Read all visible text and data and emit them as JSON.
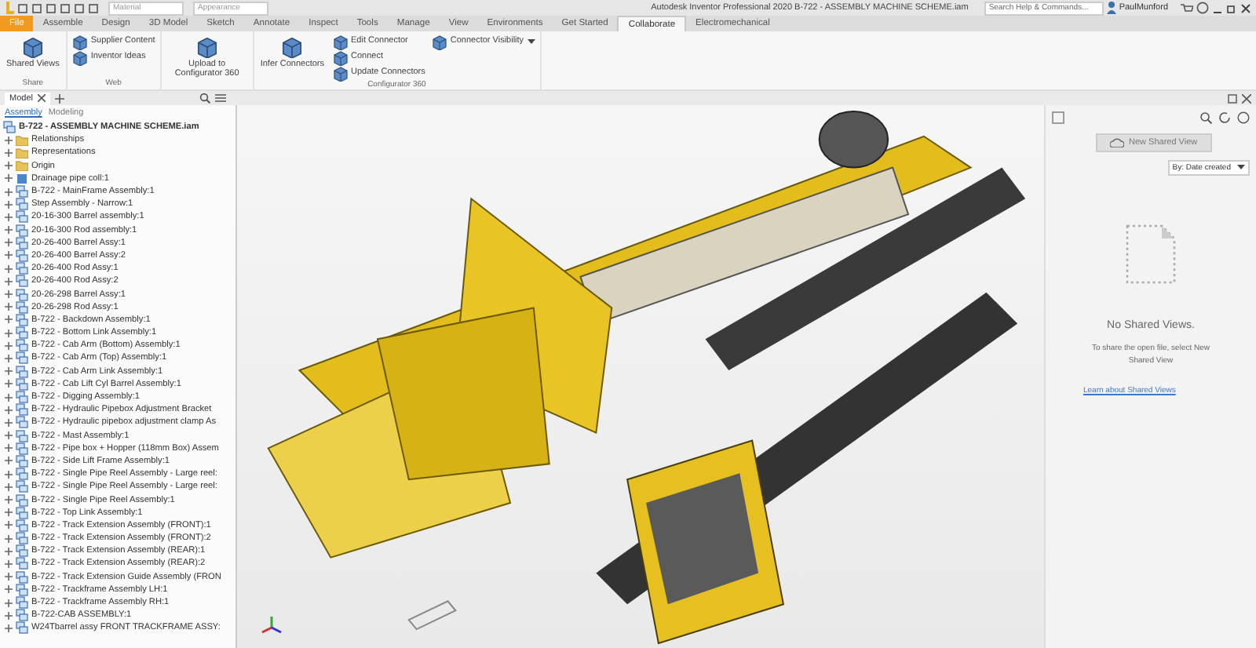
{
  "window": {
    "title": "Autodesk Inventor Professional 2020   B-722 - ASSEMBLY MACHINE SCHEME.iam"
  },
  "quick_access": {
    "material": "Material",
    "appearance": "Appearance"
  },
  "search": {
    "placeholder": "Search Help & Commands..."
  },
  "user": {
    "name": "PaulMunford"
  },
  "ribbon_tabs": [
    {
      "label": "File",
      "selected": false,
      "kind": "file"
    },
    {
      "label": "Assemble",
      "selected": false
    },
    {
      "label": "Design",
      "selected": false
    },
    {
      "label": "3D Model",
      "selected": false
    },
    {
      "label": "Sketch",
      "selected": false
    },
    {
      "label": "Annotate",
      "selected": false
    },
    {
      "label": "Inspect",
      "selected": false
    },
    {
      "label": "Tools",
      "selected": false
    },
    {
      "label": "Manage",
      "selected": false
    },
    {
      "label": "View",
      "selected": false
    },
    {
      "label": "Environments",
      "selected": false
    },
    {
      "label": "Get Started",
      "selected": false
    },
    {
      "label": "Collaborate",
      "selected": true
    },
    {
      "label": "Electromechanical",
      "selected": false
    }
  ],
  "ribbon_groups": [
    {
      "label": "Share",
      "buttons": [
        {
          "label": "Shared Views",
          "kind": "large"
        }
      ]
    },
    {
      "label": "Web",
      "buttons": [
        {
          "label": "Supplier Content",
          "kind": "small"
        },
        {
          "label": "Inventor Ideas",
          "kind": "small"
        }
      ]
    },
    {
      "buttons": [
        {
          "label": "Upload to Configurator 360",
          "kind": "large"
        }
      ]
    },
    {
      "label": "Configurator 360",
      "buttons": [
        {
          "label": "Infer Connectors",
          "kind": "large"
        },
        {
          "label": "Edit Connector",
          "kind": "small"
        },
        {
          "label": "Connect",
          "kind": "small"
        },
        {
          "label": "Update Connectors",
          "kind": "small"
        },
        {
          "label": "Connector Visibility",
          "kind": "menu"
        }
      ]
    }
  ],
  "browser": {
    "tab": "Model",
    "subtabs": [
      {
        "label": "Assembly",
        "selected": true
      },
      {
        "label": "Modeling",
        "selected": false
      }
    ],
    "tree": [
      {
        "label": "B-722 - ASSEMBLY MACHINE SCHEME.iam",
        "kind": "assembly",
        "children": [
          {
            "label": "Relationships",
            "kind": "folder",
            "expanded": false
          },
          {
            "label": "Representations",
            "kind": "folder",
            "expanded": false
          },
          {
            "label": "Origin",
            "kind": "folder",
            "expanded": false
          },
          {
            "label": "Drainage pipe coll:1",
            "kind": "part",
            "expanded": false
          },
          {
            "label": "B-722 - MainFrame Assembly:1",
            "kind": "assembly",
            "expanded": false
          },
          {
            "label": "Step Assembly - Narrow:1",
            "kind": "assembly",
            "expanded": false
          },
          {
            "label": "20-16-300 Barrel assembly:1",
            "kind": "assembly",
            "expanded": false
          },
          {
            "label": "20-16-300 Rod assembly:1",
            "kind": "assembly",
            "expanded": false
          },
          {
            "label": "20-26-400 Barrel Assy:1",
            "kind": "assembly",
            "expanded": false
          },
          {
            "label": "20-26-400 Barrel Assy:2",
            "kind": "assembly",
            "expanded": false
          },
          {
            "label": "20-26-400 Rod Assy:1",
            "kind": "assembly",
            "expanded": false
          },
          {
            "label": "20-26-400 Rod Assy:2",
            "kind": "assembly",
            "expanded": false
          },
          {
            "label": "20-26-298 Barrel Assy:1",
            "kind": "assembly",
            "expanded": false
          },
          {
            "label": "20-26-298 Rod Assy:1",
            "kind": "assembly",
            "expanded": false
          },
          {
            "label": "B-722 - Backdown Assembly:1",
            "kind": "assembly",
            "expanded": false
          },
          {
            "label": "B-722 - Bottom Link Assembly:1",
            "kind": "assembly",
            "expanded": false
          },
          {
            "label": "B-722 - Cab Arm (Bottom) Assembly:1",
            "kind": "assembly",
            "expanded": false
          },
          {
            "label": "B-722 - Cab Arm (Top) Assembly:1",
            "kind": "assembly",
            "expanded": false
          },
          {
            "label": "B-722 - Cab Arm Link Assembly:1",
            "kind": "assembly",
            "expanded": false
          },
          {
            "label": "B-722 - Cab Lift Cyl Barrel Assembly:1",
            "kind": "assembly",
            "expanded": false
          },
          {
            "label": "B-722 - Digging Assembly:1",
            "kind": "assembly",
            "expanded": false
          },
          {
            "label": "B-722 - Hydraulic Pipebox Adjustment Bracket",
            "kind": "assembly",
            "expanded": false
          },
          {
            "label": "B-722 - Hydraulic pipebox adjustment clamp As",
            "kind": "assembly",
            "expanded": false
          },
          {
            "label": "B-722 - Mast Assembly:1",
            "kind": "assembly",
            "expanded": false
          },
          {
            "label": "B-722 - Pipe box + Hopper (118mm Box) Assem",
            "kind": "assembly",
            "expanded": false
          },
          {
            "label": "B-722 - Side Lift Frame Assembly:1",
            "kind": "assembly",
            "expanded": false
          },
          {
            "label": "B-722 - Single Pipe Reel Assembly - Large reel:",
            "kind": "assembly",
            "expanded": false
          },
          {
            "label": "B-722 - Single Pipe Reel Assembly - Large reel:",
            "kind": "assembly",
            "expanded": false
          },
          {
            "label": "B-722 - Single Pipe Reel Assembly:1",
            "kind": "assembly",
            "expanded": false
          },
          {
            "label": "B-722 - Top Link Assembly:1",
            "kind": "assembly",
            "expanded": false
          },
          {
            "label": "B-722 - Track Extension Assembly (FRONT):1",
            "kind": "assembly",
            "expanded": false
          },
          {
            "label": "B-722 - Track Extension Assembly (FRONT):2",
            "kind": "assembly",
            "expanded": false
          },
          {
            "label": "B-722 - Track Extension Assembly (REAR):1",
            "kind": "assembly",
            "expanded": false
          },
          {
            "label": "B-722 - Track Extension Assembly (REAR):2",
            "kind": "assembly",
            "expanded": false
          },
          {
            "label": "B-722 - Track Extension Guide Assembly (FRON",
            "kind": "assembly",
            "expanded": false
          },
          {
            "label": "B-722 - Trackframe Assembly LH:1",
            "kind": "assembly",
            "expanded": false
          },
          {
            "label": "B-722 - Trackframe Assembly RH:1",
            "kind": "assembly",
            "expanded": false
          },
          {
            "label": "B-722-CAB ASSEMBLY:1",
            "kind": "assembly",
            "expanded": false
          },
          {
            "label": "W24Tbarrel assy FRONT TRACKFRAME ASSY:",
            "kind": "assembly",
            "expanded": false
          }
        ]
      }
    ]
  },
  "shared_views": {
    "button": "New Shared View",
    "sort": "By: Date created",
    "empty_title": "No Shared Views.",
    "empty_text": "To share the open file, select New Shared View",
    "link": "Learn about Shared Views"
  }
}
